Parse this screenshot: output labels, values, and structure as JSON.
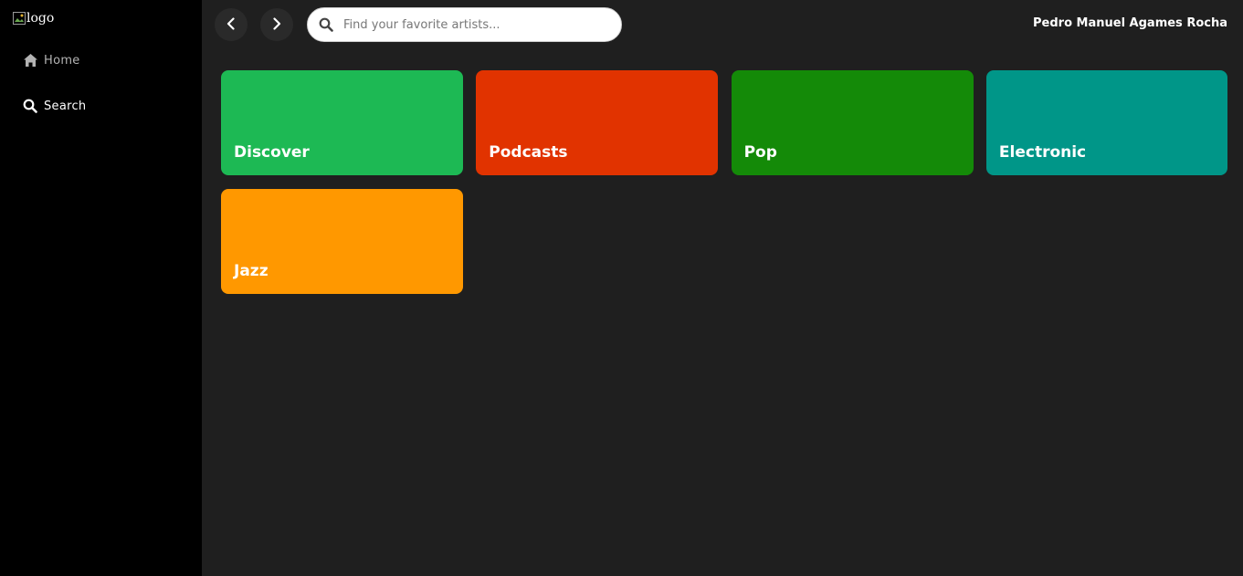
{
  "sidebar": {
    "logo_alt": "logo",
    "items": [
      {
        "label": "Home",
        "icon": "home-icon"
      },
      {
        "label": "Search",
        "icon": "search-icon"
      }
    ]
  },
  "topbar": {
    "search_placeholder": "Find your favorite artists...",
    "user_name": "Pedro Manuel Agames Rocha"
  },
  "categories": [
    {
      "label": "Discover",
      "color": "#1db954"
    },
    {
      "label": "Podcasts",
      "color": "#e13300"
    },
    {
      "label": "Pop",
      "color": "#148a08"
    },
    {
      "label": "Electronic",
      "color": "#009688"
    },
    {
      "label": "Jazz",
      "color": "#ff9800"
    }
  ]
}
